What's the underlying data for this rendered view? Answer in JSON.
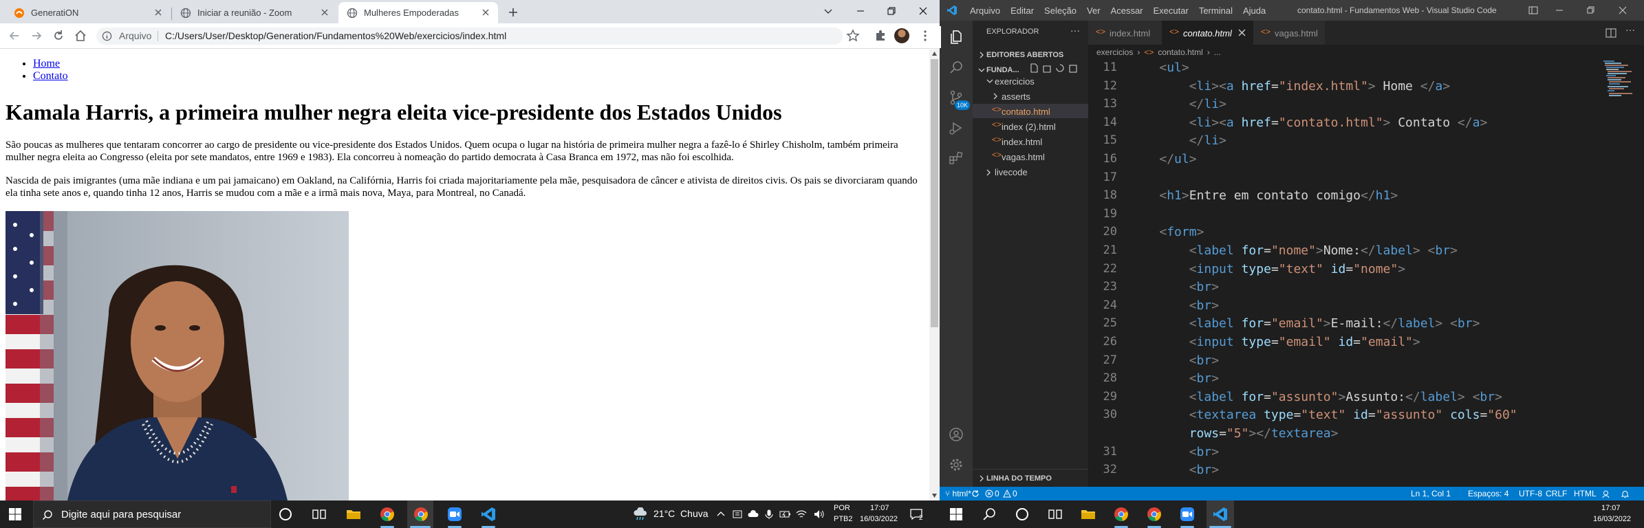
{
  "browser": {
    "tabs": [
      {
        "title": "GeneratiON",
        "active": false
      },
      {
        "title": "Iniciar a reunião - Zoom",
        "active": false
      },
      {
        "title": "Mulheres Empoderadas",
        "active": true
      }
    ],
    "security_label": "Arquivo",
    "address": "C:/Users/User/Desktop/Generation/Fundamentos%20Web/exercicios/index.html"
  },
  "page": {
    "nav": [
      "Home",
      "Contato"
    ],
    "heading": "Kamala Harris, a primeira mulher negra eleita vice-presidente dos Estados Unidos",
    "p1": "São poucas as mulheres que tentaram concorrer ao cargo de presidente ou vice-presidente dos Estados Unidos. Quem ocupa o lugar na história de primeira mulher negra a fazê-lo é Shirley Chisholm, também primeira mulher negra eleita ao Congresso (eleita por sete mandatos, entre 1969 e 1983). Ela concorreu à nomeação do partido democrata à Casa Branca em 1972, mas não foi escolhida.",
    "p2": "Nascida de pais imigrantes (uma mãe indiana e um pai jamaicano) em Oakland, na Califórnia, Harris foi criada majoritariamente pela mãe, pesquisadora de câncer e ativista de direitos civis. Os pais se divorciaram quando ela tinha sete anos e, quando tinha 12 anos, Harris se mudou com a mãe e a irmã mais nova, Maya, para Montreal, no Canadá."
  },
  "vscode": {
    "menu": [
      "Arquivo",
      "Editar",
      "Seleção",
      "Ver",
      "Acessar",
      "Executar",
      "Terminal",
      "Ajuda"
    ],
    "window_title": "contato.html - Fundamentos Web - Visual Studio Code",
    "explorer_title": "EXPLORADOR",
    "open_editors": "EDITORES ABERTOS",
    "project": "FUNDA...",
    "tree": {
      "folder": "exercicios",
      "items": [
        "asserts",
        "contato.html",
        "index (2).html",
        "index.html",
        "vagas.html"
      ],
      "sibling": "livecode"
    },
    "timeline": "LINHA DO TEMPO",
    "scm_badge": "10K",
    "editor_tabs": [
      "index.html",
      "contato.html",
      "vagas.html"
    ],
    "breadcrumb": [
      "exercicios",
      "contato.html",
      "..."
    ],
    "status": {
      "left": "html*",
      "errors": "0",
      "warnings": "0",
      "position": "Ln 1, Col 1",
      "spaces": "Espaços: 4",
      "encoding": "UTF-8",
      "eol": "CRLF",
      "language": "HTML"
    }
  },
  "code_lines": [
    {
      "n": "11",
      "segs": [
        [
          "x",
          "    "
        ],
        [
          "p",
          "<"
        ],
        [
          "t",
          "ul"
        ],
        [
          "p",
          ">"
        ]
      ]
    },
    {
      "n": "12",
      "segs": [
        [
          "x",
          "        "
        ],
        [
          "p",
          "<"
        ],
        [
          "t",
          "li"
        ],
        [
          "p",
          "><"
        ],
        [
          "t",
          "a "
        ],
        [
          "a",
          "href"
        ],
        [
          "x",
          "="
        ],
        [
          "s",
          "\"index.html\""
        ],
        [
          "p",
          ">"
        ],
        [
          "x",
          " Home "
        ],
        [
          "p",
          "</"
        ],
        [
          "t",
          "a"
        ],
        [
          "p",
          ">"
        ]
      ]
    },
    {
      "n": "13",
      "segs": [
        [
          "x",
          "        "
        ],
        [
          "p",
          "</"
        ],
        [
          "t",
          "li"
        ],
        [
          "p",
          ">"
        ]
      ]
    },
    {
      "n": "14",
      "segs": [
        [
          "x",
          "        "
        ],
        [
          "p",
          "<"
        ],
        [
          "t",
          "li"
        ],
        [
          "p",
          "><"
        ],
        [
          "t",
          "a "
        ],
        [
          "a",
          "href"
        ],
        [
          "x",
          "="
        ],
        [
          "s",
          "\"contato.html\""
        ],
        [
          "p",
          ">"
        ],
        [
          "x",
          " Contato "
        ],
        [
          "p",
          "</"
        ],
        [
          "t",
          "a"
        ],
        [
          "p",
          ">"
        ]
      ]
    },
    {
      "n": "15",
      "segs": [
        [
          "x",
          "        "
        ],
        [
          "p",
          "</"
        ],
        [
          "t",
          "li"
        ],
        [
          "p",
          ">"
        ]
      ]
    },
    {
      "n": "16",
      "segs": [
        [
          "x",
          "    "
        ],
        [
          "p",
          "</"
        ],
        [
          "t",
          "ul"
        ],
        [
          "p",
          ">"
        ]
      ]
    },
    {
      "n": "17",
      "segs": []
    },
    {
      "n": "18",
      "segs": [
        [
          "x",
          "    "
        ],
        [
          "p",
          "<"
        ],
        [
          "t",
          "h1"
        ],
        [
          "p",
          ">"
        ],
        [
          "x",
          "Entre em contato comigo"
        ],
        [
          "p",
          "</"
        ],
        [
          "t",
          "h1"
        ],
        [
          "p",
          ">"
        ]
      ]
    },
    {
      "n": "19",
      "segs": []
    },
    {
      "n": "20",
      "segs": [
        [
          "x",
          "    "
        ],
        [
          "p",
          "<"
        ],
        [
          "t",
          "form"
        ],
        [
          "p",
          ">"
        ]
      ]
    },
    {
      "n": "21",
      "segs": [
        [
          "x",
          "        "
        ],
        [
          "p",
          "<"
        ],
        [
          "t",
          "label "
        ],
        [
          "a",
          "for"
        ],
        [
          "x",
          "="
        ],
        [
          "s",
          "\"nome\""
        ],
        [
          "p",
          ">"
        ],
        [
          "x",
          "Nome:"
        ],
        [
          "p",
          "</"
        ],
        [
          "t",
          "label"
        ],
        [
          "p",
          "> <"
        ],
        [
          "t",
          "br"
        ],
        [
          "p",
          ">"
        ]
      ]
    },
    {
      "n": "22",
      "segs": [
        [
          "x",
          "        "
        ],
        [
          "p",
          "<"
        ],
        [
          "t",
          "input "
        ],
        [
          "a",
          "type"
        ],
        [
          "x",
          "="
        ],
        [
          "s",
          "\"text\""
        ],
        [
          "x",
          " "
        ],
        [
          "a",
          "id"
        ],
        [
          "x",
          "="
        ],
        [
          "s",
          "\"nome\""
        ],
        [
          "p",
          ">"
        ]
      ]
    },
    {
      "n": "23",
      "segs": [
        [
          "x",
          "        "
        ],
        [
          "p",
          "<"
        ],
        [
          "t",
          "br"
        ],
        [
          "p",
          ">"
        ]
      ]
    },
    {
      "n": "24",
      "segs": [
        [
          "x",
          "        "
        ],
        [
          "p",
          "<"
        ],
        [
          "t",
          "br"
        ],
        [
          "p",
          ">"
        ]
      ]
    },
    {
      "n": "25",
      "segs": [
        [
          "x",
          "        "
        ],
        [
          "p",
          "<"
        ],
        [
          "t",
          "label "
        ],
        [
          "a",
          "for"
        ],
        [
          "x",
          "="
        ],
        [
          "s",
          "\"email\""
        ],
        [
          "p",
          ">"
        ],
        [
          "x",
          "E-mail:"
        ],
        [
          "p",
          "</"
        ],
        [
          "t",
          "label"
        ],
        [
          "p",
          "> <"
        ],
        [
          "t",
          "br"
        ],
        [
          "p",
          ">"
        ]
      ]
    },
    {
      "n": "26",
      "segs": [
        [
          "x",
          "        "
        ],
        [
          "p",
          "<"
        ],
        [
          "t",
          "input "
        ],
        [
          "a",
          "type"
        ],
        [
          "x",
          "="
        ],
        [
          "s",
          "\"email\""
        ],
        [
          "x",
          " "
        ],
        [
          "a",
          "id"
        ],
        [
          "x",
          "="
        ],
        [
          "s",
          "\"email\""
        ],
        [
          "p",
          ">"
        ]
      ]
    },
    {
      "n": "27",
      "segs": [
        [
          "x",
          "        "
        ],
        [
          "p",
          "<"
        ],
        [
          "t",
          "br"
        ],
        [
          "p",
          ">"
        ]
      ]
    },
    {
      "n": "28",
      "segs": [
        [
          "x",
          "        "
        ],
        [
          "p",
          "<"
        ],
        [
          "t",
          "br"
        ],
        [
          "p",
          ">"
        ]
      ]
    },
    {
      "n": "29",
      "segs": [
        [
          "x",
          "        "
        ],
        [
          "p",
          "<"
        ],
        [
          "t",
          "label "
        ],
        [
          "a",
          "for"
        ],
        [
          "x",
          "="
        ],
        [
          "s",
          "\"assunto\""
        ],
        [
          "p",
          ">"
        ],
        [
          "x",
          "Assunto:"
        ],
        [
          "p",
          "</"
        ],
        [
          "t",
          "label"
        ],
        [
          "p",
          "> <"
        ],
        [
          "t",
          "br"
        ],
        [
          "p",
          ">"
        ]
      ]
    },
    {
      "n": "30",
      "segs": [
        [
          "x",
          "        "
        ],
        [
          "p",
          "<"
        ],
        [
          "t",
          "textarea "
        ],
        [
          "a",
          "type"
        ],
        [
          "x",
          "="
        ],
        [
          "s",
          "\"text\""
        ],
        [
          "x",
          " "
        ],
        [
          "a",
          "id"
        ],
        [
          "x",
          "="
        ],
        [
          "s",
          "\"assunto\""
        ],
        [
          "x",
          " "
        ],
        [
          "a",
          "cols"
        ],
        [
          "x",
          "="
        ],
        [
          "s",
          "\"60\""
        ]
      ]
    },
    {
      "n": "",
      "segs": [
        [
          "x",
          "        "
        ],
        [
          "a",
          "rows"
        ],
        [
          "x",
          "="
        ],
        [
          "s",
          "\"5\""
        ],
        [
          "p",
          "></"
        ],
        [
          "t",
          "textarea"
        ],
        [
          "p",
          ">"
        ]
      ]
    },
    {
      "n": "31",
      "segs": [
        [
          "x",
          "        "
        ],
        [
          "p",
          "<"
        ],
        [
          "t",
          "br"
        ],
        [
          "p",
          ">"
        ]
      ]
    },
    {
      "n": "32",
      "segs": [
        [
          "x",
          "        "
        ],
        [
          "p",
          "<"
        ],
        [
          "t",
          "br"
        ],
        [
          "p",
          ">"
        ]
      ]
    }
  ],
  "taskbar": {
    "search_placeholder": "Digite aqui para pesquisar",
    "weather": "21°C  Chuva",
    "lang1": "POR",
    "lang2": "PTB2",
    "time": "17:07",
    "date": "16/03/2022",
    "notifications": "2"
  },
  "colors": {
    "statusbar": "#007acc",
    "link": "#0000ee",
    "accent_orange": "#f0a24b"
  }
}
